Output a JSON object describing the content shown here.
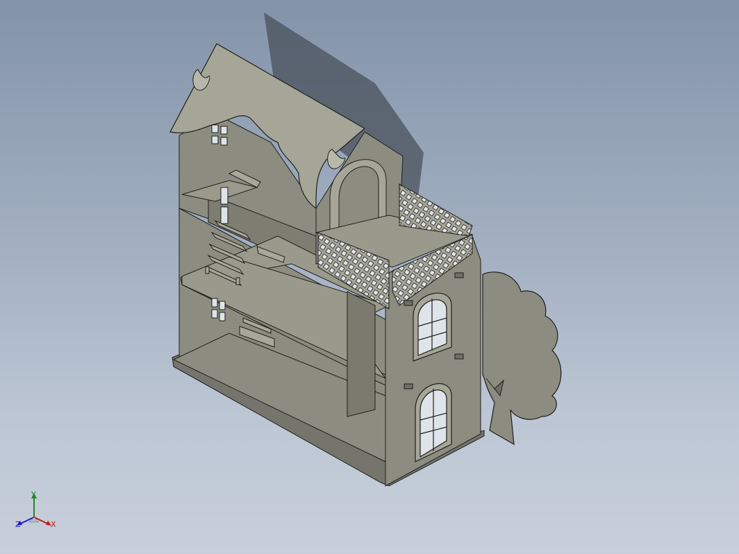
{
  "viewport": {
    "background_top": "#8393a9",
    "background_bottom": "#c7cfdb",
    "model_color": "#8c8c80",
    "model_light": "#a6a698",
    "model_dark": "#6f6f65",
    "edge_color": "#1e1e1a"
  },
  "model": {
    "parts": [
      "roof",
      "left-wall",
      "front-wall",
      "floor-shelves",
      "staircase",
      "balcony-lattice",
      "arched-window",
      "arched-door",
      "tree-panel",
      "butterfly-decorations"
    ]
  },
  "triad": {
    "x_label": "X",
    "y_label": "Y",
    "z_label": "Z",
    "x_color": "#c81414",
    "y_color": "#1f8a1f",
    "z_color": "#1c1ccc"
  }
}
